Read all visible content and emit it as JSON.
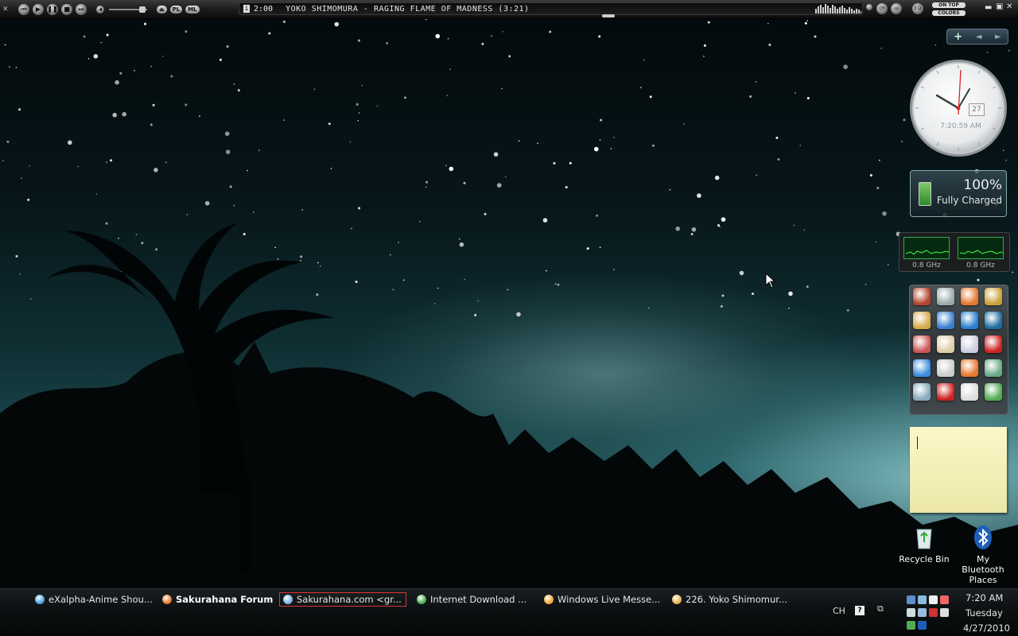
{
  "media_player": {
    "time": "2:00",
    "track": "YOKO SHIMOMURA - RAGING FLAME OF MADNESS (3:21)",
    "pill_pl": "PL",
    "pill_ml": "ML",
    "on_top": "ON TOP",
    "colors": "COLORS",
    "eq": "EQ"
  },
  "gadgets": {
    "toolbar_add": "+",
    "clock": {
      "time_text": "7:20:59 AM",
      "date": "27"
    },
    "battery": {
      "percent": "100%",
      "status": "Fully Charged"
    },
    "cpu": {
      "core1": "0.8 GHz",
      "core2": "0.8 GHz"
    },
    "launcher_icons": [
      "app-icon",
      "notes-icon",
      "firefox-icon",
      "keys-icon",
      "mcafee-icon",
      "feather-icon",
      "globe-icon",
      "e-icon",
      "paint-icon",
      "edit-icon",
      "document-icon",
      "pdf-icon",
      "chrome-icon",
      "text-icon",
      "firefox-icon",
      "monitor-icon",
      "network-icon",
      "filezilla-icon",
      "notepad-icon",
      "upload-icon"
    ]
  },
  "desktop_icons": [
    {
      "label": "Recycle Bin"
    },
    {
      "label": "My Bluetooth Places"
    }
  ],
  "taskbar": {
    "tasks": [
      {
        "label": "eXalpha-Anime Shou...",
        "icon": "chrome-icon",
        "color": "#4aa3df"
      },
      {
        "label": "Sakurahana Forums ...",
        "icon": "firefox-icon",
        "color": "#e8772e"
      },
      {
        "label": "Sakurahana.com <gr...",
        "icon": "messenger-icon",
        "color": "#7fb3e0"
      },
      {
        "label": "Internet Download ...",
        "icon": "download-icon",
        "color": "#4caf50"
      },
      {
        "label": "Windows Live Messe...",
        "icon": "live-messenger-icon",
        "color": "#f0a830"
      },
      {
        "label": "226. Yoko Shimomur...",
        "icon": "winamp-icon",
        "color": "#e6b34a"
      }
    ],
    "lang": "CH",
    "help": "?",
    "clock": {
      "time": "7:20 AM",
      "day": "Tuesday",
      "date": "4/27/2010"
    }
  }
}
